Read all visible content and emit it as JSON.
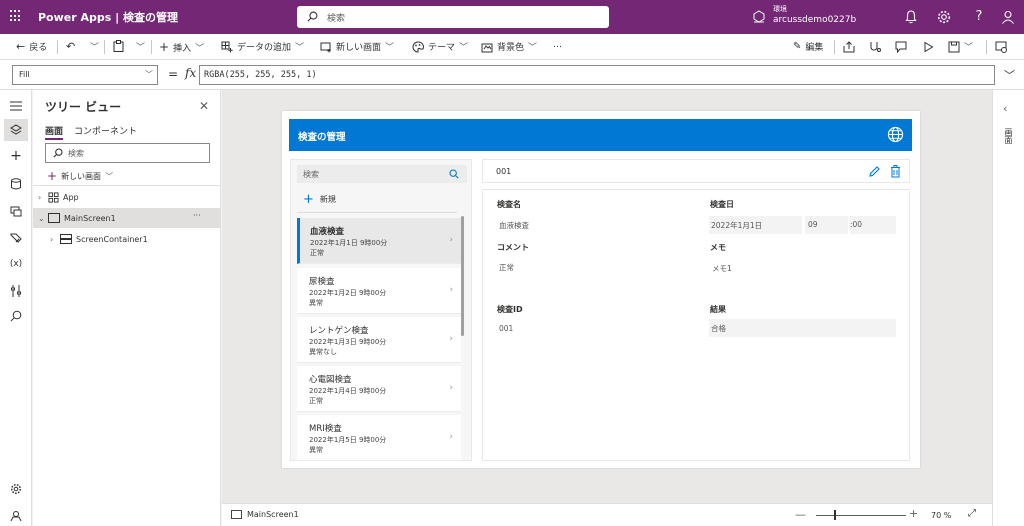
{
  "topbar": {
    "app_title": "Power Apps | 検査の管理",
    "search_placeholder": "検索",
    "env_label": "環境",
    "env_name": "arcussdemo0227b",
    "color": "#742774"
  },
  "command_bar": {
    "back": "戻る",
    "insert": "挿入",
    "add_data": "データの追加",
    "new_screen": "新しい画面",
    "theme": "テーマ",
    "background": "背景色",
    "more": "…",
    "edit": "編集"
  },
  "formula_bar": {
    "property": "Fill",
    "equals": "=",
    "fx": "fx",
    "formula": "RGBA(255, 255, 255, 1)"
  },
  "tree_view": {
    "title": "ツリー ビュー",
    "tabs": [
      "画面",
      "コンポーネント"
    ],
    "search_placeholder": "検索",
    "new_screen": "新しい画面",
    "nodes": [
      {
        "label": "App"
      },
      {
        "label": "MainScreen1",
        "selected": true
      },
      {
        "label": "ScreenContainer1"
      }
    ],
    "more": "···"
  },
  "app": {
    "header_title": "検査の管理",
    "accent": "#0078d4",
    "gallery": {
      "search_placeholder": "検索",
      "new_label": "新規",
      "items": [
        {
          "name": "血液検査",
          "date": "2022年1月1日 9時00分",
          "result": "正常"
        },
        {
          "name": "尿検査",
          "date": "2022年1月2日 9時00分",
          "result": "異常"
        },
        {
          "name": "レントゲン検査",
          "date": "2022年1月3日 9時00分",
          "result": "異常なし"
        },
        {
          "name": "心電図検査",
          "date": "2022年1月4日 9時00分",
          "result": "正常"
        },
        {
          "name": "MRI検査",
          "date": "2022年1月5日 9時00分",
          "result": "異常"
        }
      ]
    },
    "detail": {
      "id_header": "001",
      "fields": {
        "name_label": "検査名",
        "name_value": "血液検査",
        "date_label": "検査日",
        "date_value": "2022年1月1日",
        "hour_value": "09",
        "minute_value": ":00",
        "comment_label": "コメント",
        "comment_value": "正常",
        "memo_label": "メモ",
        "memo_value": "メモ1",
        "id_label": "検査ID",
        "id_value": "001",
        "result_label": "結果",
        "result_value": "合格"
      }
    }
  },
  "right_pane": {
    "label": "画面"
  },
  "bottom_bar": {
    "screen_name": "MainScreen1",
    "zoom": "70 %"
  }
}
